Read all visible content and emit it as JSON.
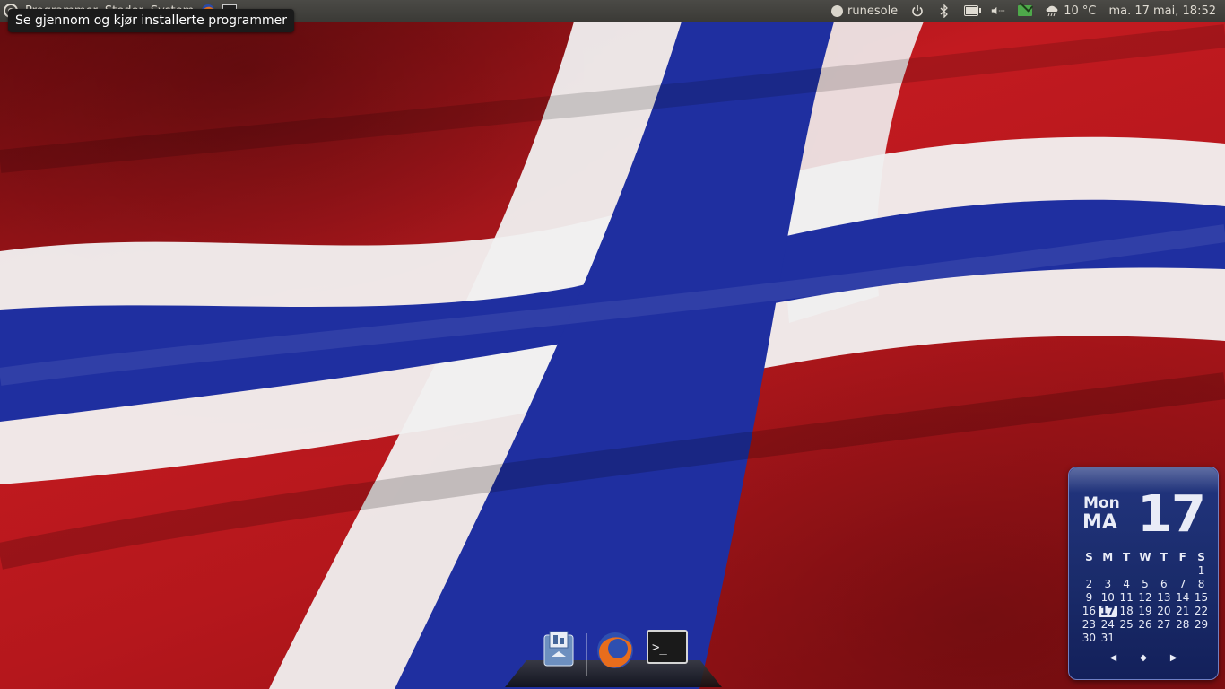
{
  "top_panel": {
    "menus": [
      "Programmer",
      "Steder",
      "System"
    ],
    "user": "runesole",
    "weather": "10 °C",
    "datetime": "ma. 17 mai, 18:52",
    "battery_level": 0.8
  },
  "tooltip": {
    "text": "Se gjennom og kjør installerte programmer"
  },
  "calendar": {
    "day_en": "Mon",
    "day_no": "MA",
    "date_big": "17",
    "weekday_headers": [
      "S",
      "M",
      "T",
      "W",
      "T",
      "F",
      "S"
    ],
    "weeks": [
      [
        "",
        "",
        "",
        "",
        "",
        "",
        "1"
      ],
      [
        "2",
        "3",
        "4",
        "5",
        "6",
        "7",
        "8"
      ],
      [
        "9",
        "10",
        "11",
        "12",
        "13",
        "14",
        "15"
      ],
      [
        "16",
        "17",
        "18",
        "19",
        "20",
        "21",
        "22"
      ],
      [
        "23",
        "24",
        "25",
        "26",
        "27",
        "28",
        "29"
      ],
      [
        "30",
        "31",
        "",
        "",
        "",
        "",
        ""
      ]
    ],
    "today": "17",
    "nav": [
      "◀",
      "◆",
      "▶"
    ]
  },
  "dock": {
    "items": [
      "home-folder-icon",
      "firefox-icon",
      "terminal-icon"
    ]
  },
  "colors": {
    "flag_red": "#c21a20",
    "flag_blue": "#1f2fa0",
    "flag_white": "#f2f2f2",
    "calendar_bg": "#1a2b6a",
    "panel_bg": "#3b3a36"
  }
}
